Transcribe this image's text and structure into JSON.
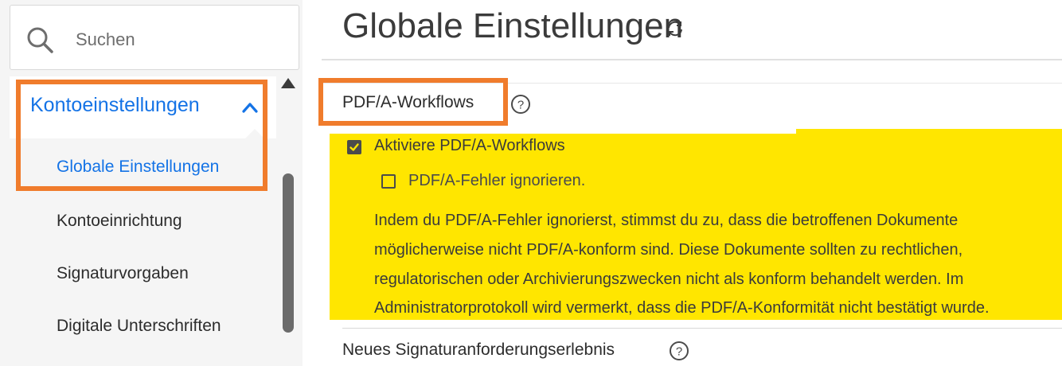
{
  "search": {
    "placeholder": "Suchen",
    "icon": "search-icon"
  },
  "sidebar": {
    "group": {
      "label": "Kontoeinstellungen",
      "icon": "chevron-up-icon",
      "color": "#1473e6"
    },
    "items": [
      {
        "label": "Globale Einstellungen",
        "active": true
      },
      {
        "label": "Kontoeinrichtung",
        "active": false
      },
      {
        "label": "Signaturvorgaben",
        "active": false
      },
      {
        "label": "Digitale Unterschriften",
        "active": false
      }
    ]
  },
  "main": {
    "title": "Globale Einstellungen",
    "title_icon": "refresh-icon",
    "sections": [
      {
        "heading": "PDF/A-Workflows",
        "help_icon": "help-icon",
        "options": [
          {
            "label": "Aktiviere PDF/A-Workflows",
            "checked": true
          },
          {
            "label": "PDF/A-Fehler ignorieren.",
            "checked": false
          }
        ],
        "description_lines": [
          "Indem du PDF/A-Fehler ignorierst, stimmst du zu, dass die betroffenen Dokumente",
          "möglicherweise nicht PDF/A-konform sind. Diese Dokumente sollten zu rechtlichen,",
          "regulatorischen oder Archivierungszwecken nicht als konform behandelt werden. Im",
          "Administratorprotokoll wird vermerkt, dass die PDF/A-Konformität nicht bestätigt wurde."
        ]
      },
      {
        "heading": "Neues Signaturanforderungserlebnis",
        "help_icon": "help-icon"
      }
    ]
  },
  "colors": {
    "highlight_border": "#f07c2c",
    "highlight_fill": "#ffe600",
    "accent": "#1473e6"
  }
}
